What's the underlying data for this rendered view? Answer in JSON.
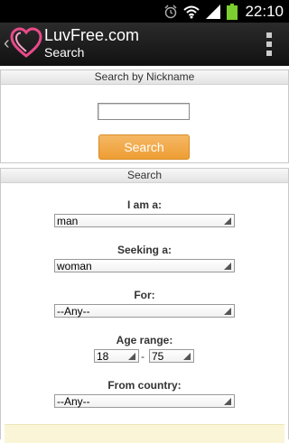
{
  "status_bar": {
    "time": "22:10",
    "icons": [
      "alarm-icon",
      "wifi-icon",
      "signal-icon",
      "battery-icon"
    ]
  },
  "action_bar": {
    "title": "LuvFree.com",
    "subtitle": "Search",
    "logo_icon": "heart-logo-icon",
    "back_icon": "chevron-left-icon",
    "menu_icon": "overflow-menu-icon"
  },
  "nickname_section": {
    "header": "Search by Nickname",
    "input_value": "",
    "button_label": "Search",
    "button_color": "#f0a540"
  },
  "search_section": {
    "header": "Search",
    "i_am": {
      "label": "I am a:",
      "value": "man"
    },
    "seeking": {
      "label": "Seeking a:",
      "value": "woman"
    },
    "for": {
      "label": "For:",
      "value": "--Any--"
    },
    "age_range": {
      "label": "Age range:",
      "min": "18",
      "separator": "-",
      "max": "75"
    },
    "country": {
      "label": "From country:",
      "value": "--Any--"
    }
  }
}
